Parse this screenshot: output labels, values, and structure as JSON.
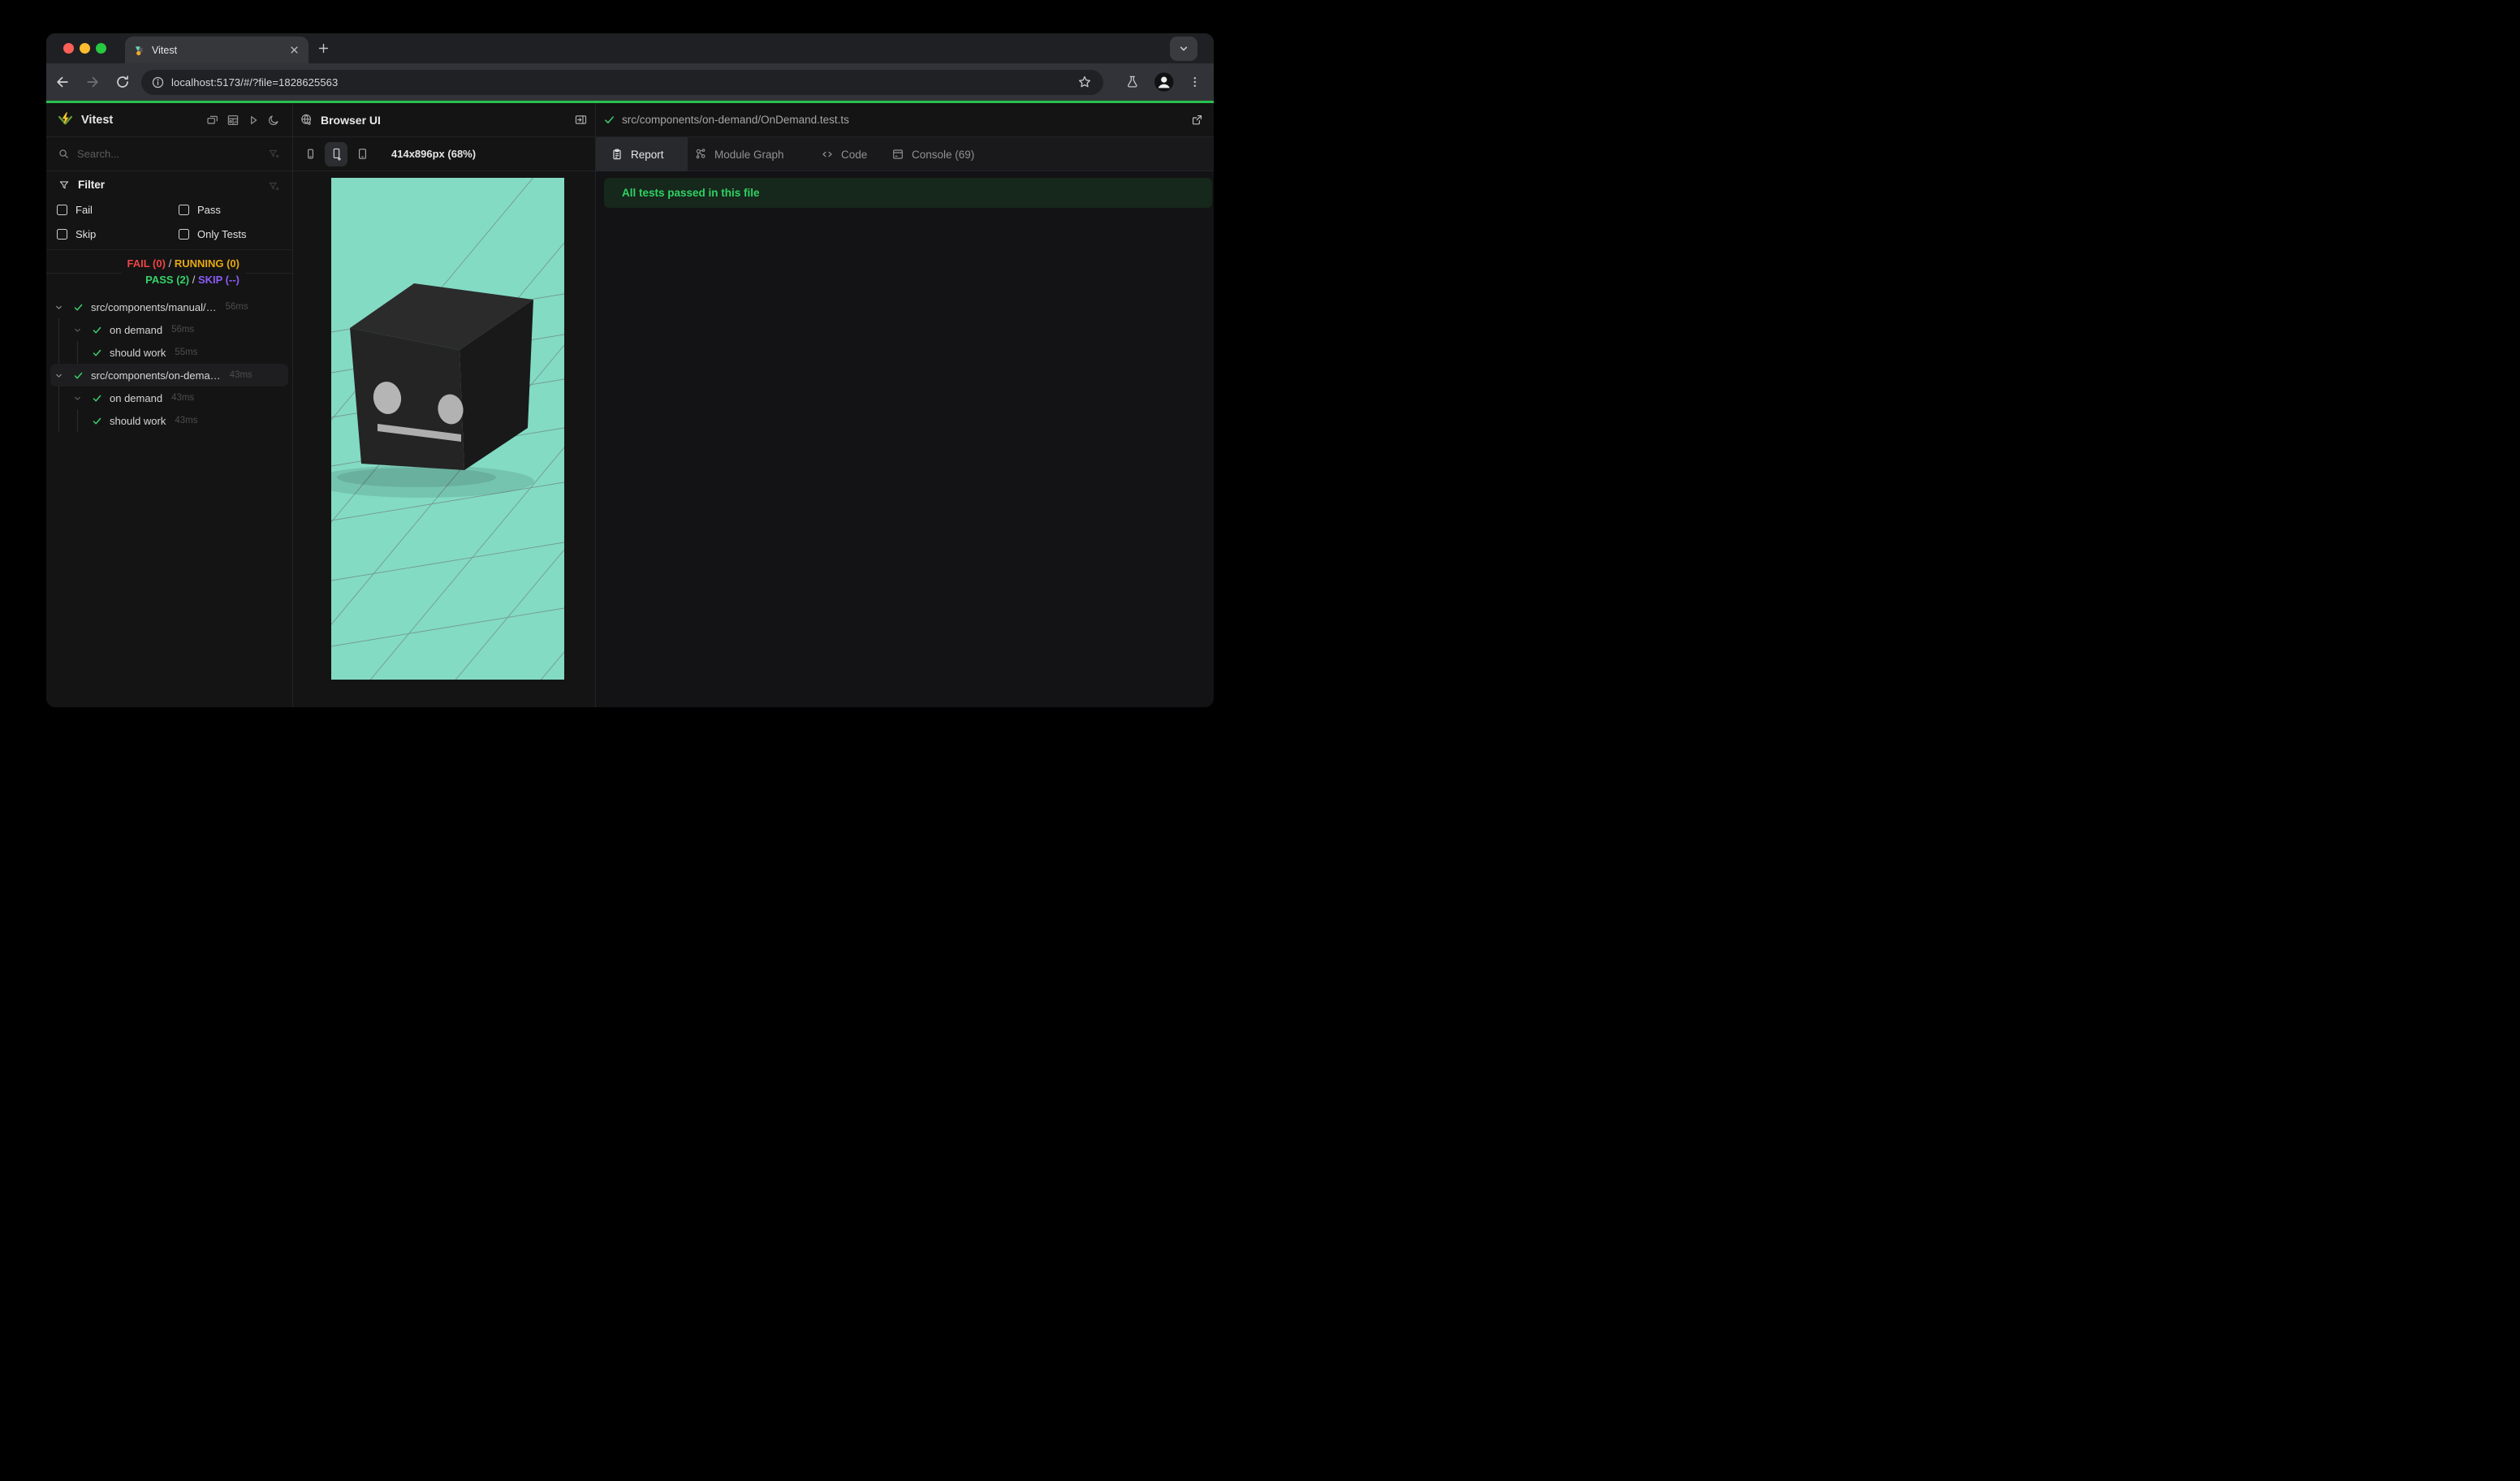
{
  "browser_chrome": {
    "tab_title": "Vitest",
    "url": "localhost:5173/#/?file=1828625563"
  },
  "sidebar": {
    "app_name": "Vitest",
    "search_placeholder": "Search...",
    "filter": {
      "title": "Filter",
      "options": [
        {
          "label": "Fail",
          "checked": false
        },
        {
          "label": "Pass",
          "checked": false
        },
        {
          "label": "Skip",
          "checked": false
        },
        {
          "label": "Only Tests",
          "checked": false
        }
      ]
    },
    "stats": {
      "fail": "FAIL (0)",
      "running": "RUNNING (0)",
      "pass": "PASS (2)",
      "skip": "SKIP (--)",
      "separator": "/"
    },
    "tree": [
      {
        "label": "src/components/manual/…",
        "time": "56ms",
        "kind": "file",
        "status": "pass",
        "selected": false
      },
      {
        "label": "on demand",
        "time": "56ms",
        "kind": "suite",
        "status": "pass",
        "selected": false
      },
      {
        "label": "should work",
        "time": "55ms",
        "kind": "test",
        "status": "pass",
        "selected": false
      },
      {
        "label": "src/components/on-dema…",
        "time": "43ms",
        "kind": "file",
        "status": "pass",
        "selected": true
      },
      {
        "label": "on demand",
        "time": "43ms",
        "kind": "suite",
        "status": "pass",
        "selected": false
      },
      {
        "label": "should work",
        "time": "43ms",
        "kind": "test",
        "status": "pass",
        "selected": false
      }
    ]
  },
  "browser_panel": {
    "title": "Browser UI",
    "viewport_label": "414x896px (68%)"
  },
  "report_panel": {
    "file_path": "src/components/on-demand/OnDemand.test.ts",
    "file_status": "pass",
    "tabs": [
      {
        "label": "Report",
        "active": true
      },
      {
        "label": "Module Graph",
        "active": false
      },
      {
        "label": "Code",
        "active": false
      },
      {
        "label": "Console (69)",
        "active": false
      }
    ],
    "banner_text": "All tests passed in this file"
  },
  "colors": {
    "accent_green_line": "#28c24e",
    "pass_green": "#36d368",
    "fail_red": "#ef4444",
    "running_yellow": "#e8a912",
    "skip_purple": "#8b5cf6",
    "viewport_background": "#83dbc4",
    "banner_background": "#16271c",
    "banner_text": "#2fd263"
  }
}
